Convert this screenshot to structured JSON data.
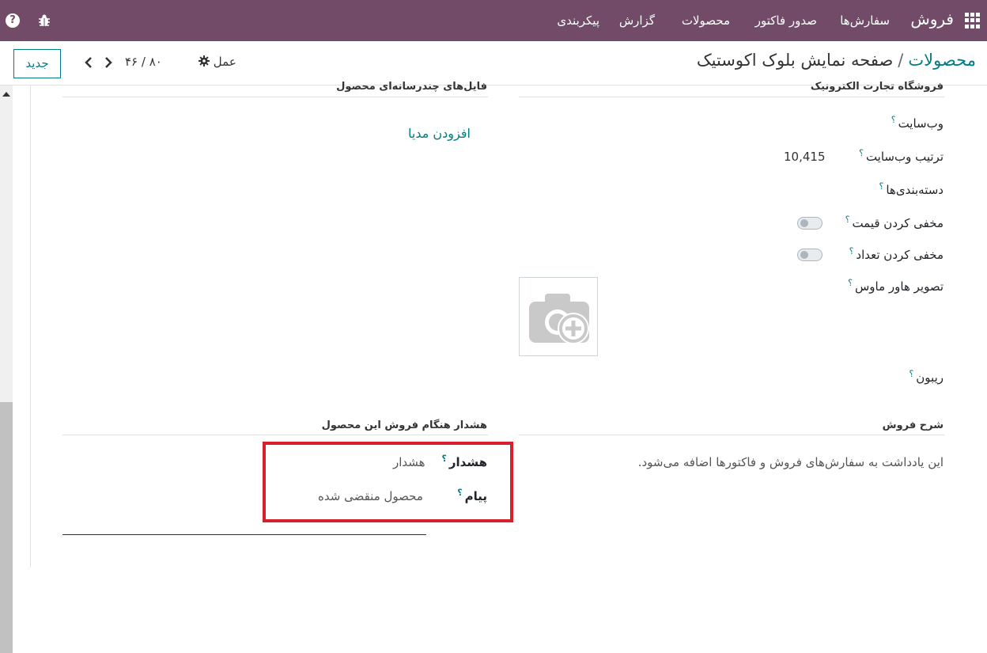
{
  "navbar": {
    "brand": "فروش",
    "menu": [
      "سفارش‌ها",
      "صدور فاکتور",
      "محصولات",
      "گزارش",
      "پیکربندی"
    ],
    "help_glyph": "?",
    "icons": [
      "apps-grid-icon",
      "bug-icon",
      "help-icon"
    ],
    "bg_color": "#714b67"
  },
  "control_panel": {
    "breadcrumb_parent": "محصولات",
    "breadcrumb_separator": "/",
    "breadcrumb_current": "صفحه نمایش بلوک اکوستیک",
    "new_button": "جدید",
    "pager": "۴۶ / ۸۰",
    "action_label": "عمل"
  },
  "form": {
    "ecommerce_title": "فروشگاه تجارت الکترونیک",
    "media_title": "فایل‌های چندرسانه‌ای محصول",
    "add_media": "افزودن مدیا",
    "website_label": "وب‌سایت",
    "website_seq_label": "ترتیب وب‌سایت",
    "website_seq_value": "10,415",
    "categories_label": "دسته‌بندی‌ها",
    "hide_price_label": "مخفی کردن قیمت",
    "hide_qty_label": "مخفی کردن تعداد",
    "hover_image_label": "تصویر هاور ماوس",
    "ribbon_label": "ریبون",
    "sales_desc_title": "شرح فروش",
    "sales_desc_text": "این یادداشت به سفارش‌های فروش و فاکتورها اضافه می‌شود.",
    "warning_title": "هشدار هنگام فروش این محصول",
    "warning_label": "هشدار",
    "warning_value": "هشدار",
    "message_label": "پیام",
    "message_value": "محصول منقضی شده",
    "help_mark": "؟",
    "accent_color": "#017e84",
    "highlight_color": "#d6202e"
  }
}
